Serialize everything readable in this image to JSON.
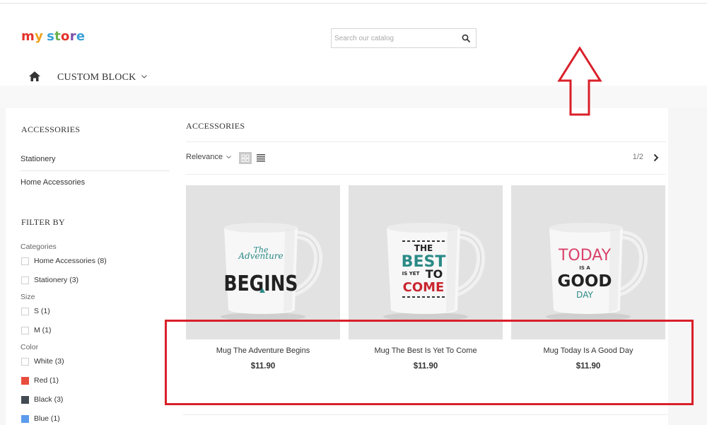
{
  "header": {
    "logo": [
      "m",
      "y",
      " ",
      "s",
      "t",
      "o",
      "r",
      "e"
    ],
    "logo_colors": [
      "#e4322b",
      "#f0a01c",
      "#ffffff",
      "#3aa0d8",
      "#6cb04d",
      "#e4322b",
      "#7b4fa6",
      "#3aa0d8"
    ],
    "search_placeholder": "Search our catalog",
    "search_value": "",
    "search_icon": "magnifier-icon"
  },
  "nav": {
    "home_icon": "home-icon",
    "custom_label": "CUSTOM BLOCK"
  },
  "sidebar": {
    "heading": "ACCESSORIES",
    "links": [
      "Stationery",
      "Home Accessories"
    ],
    "filter_heading": "FILTER BY",
    "facets": [
      {
        "title": "Categories",
        "items": [
          {
            "label": "Home Accessories (8)",
            "type": "checkbox"
          },
          {
            "label": "Stationery (3)",
            "type": "checkbox"
          }
        ]
      },
      {
        "title": "Size",
        "items": [
          {
            "label": "S (1)",
            "type": "checkbox"
          },
          {
            "label": "M (1)",
            "type": "checkbox"
          }
        ]
      },
      {
        "title": "Color",
        "items": [
          {
            "label": "White (3)",
            "type": "swatch",
            "color": "#ffffff"
          },
          {
            "label": "Red (1)",
            "type": "swatch",
            "color": "#e84c3d"
          },
          {
            "label": "Black (3)",
            "type": "swatch",
            "color": "#434a54"
          },
          {
            "label": "Blue (1)",
            "type": "swatch",
            "color": "#5d9cec"
          }
        ]
      }
    ]
  },
  "main": {
    "title": "ACCESSORIES",
    "sort_label": "Relevance",
    "pager": "1/2",
    "products": [
      {
        "name": "Mug The Adventure Begins",
        "price": "$11.90",
        "art": [
          "The",
          "Adventure",
          "BEGINS"
        ]
      },
      {
        "name": "Mug The Best Is Yet To Come",
        "price": "$11.90",
        "art": [
          "THE",
          "BEST",
          "IS YET",
          "TO",
          "COME"
        ]
      },
      {
        "name": "Mug Today Is A Good Day",
        "price": "$11.90",
        "art": [
          "TODAY",
          "IS A",
          "GOOD",
          "DAY"
        ]
      }
    ]
  },
  "colors": {
    "annotation": "#d9202a",
    "accent_teal": "#2a8a86"
  }
}
